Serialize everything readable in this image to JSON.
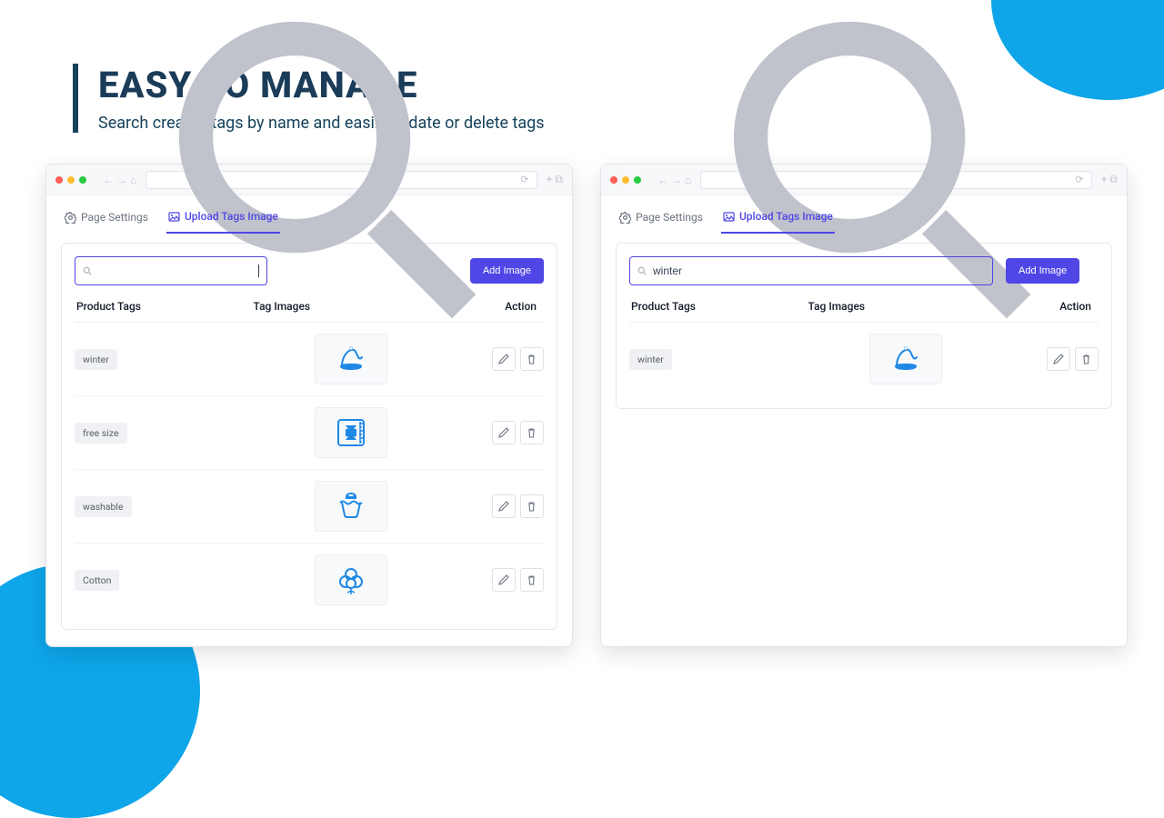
{
  "headline": "EASY TO MANAGE",
  "subhead": "Search created tags by name and easily update or delete tags",
  "tabs": {
    "page_settings": "Page Settings",
    "upload": "Upload Tags Image"
  },
  "add_image": "Add Image",
  "columns": {
    "tags": "Product Tags",
    "images": "Tag Images",
    "action": "Action"
  },
  "left": {
    "search_value": "",
    "rows": [
      {
        "tag": "winter",
        "icon": "hat"
      },
      {
        "tag": "free size",
        "icon": "size"
      },
      {
        "tag": "washable",
        "icon": "wash"
      },
      {
        "tag": "Cotton",
        "icon": "cotton"
      }
    ]
  },
  "right": {
    "search_value": "winter",
    "rows": [
      {
        "tag": "winter",
        "icon": "hat"
      }
    ]
  }
}
